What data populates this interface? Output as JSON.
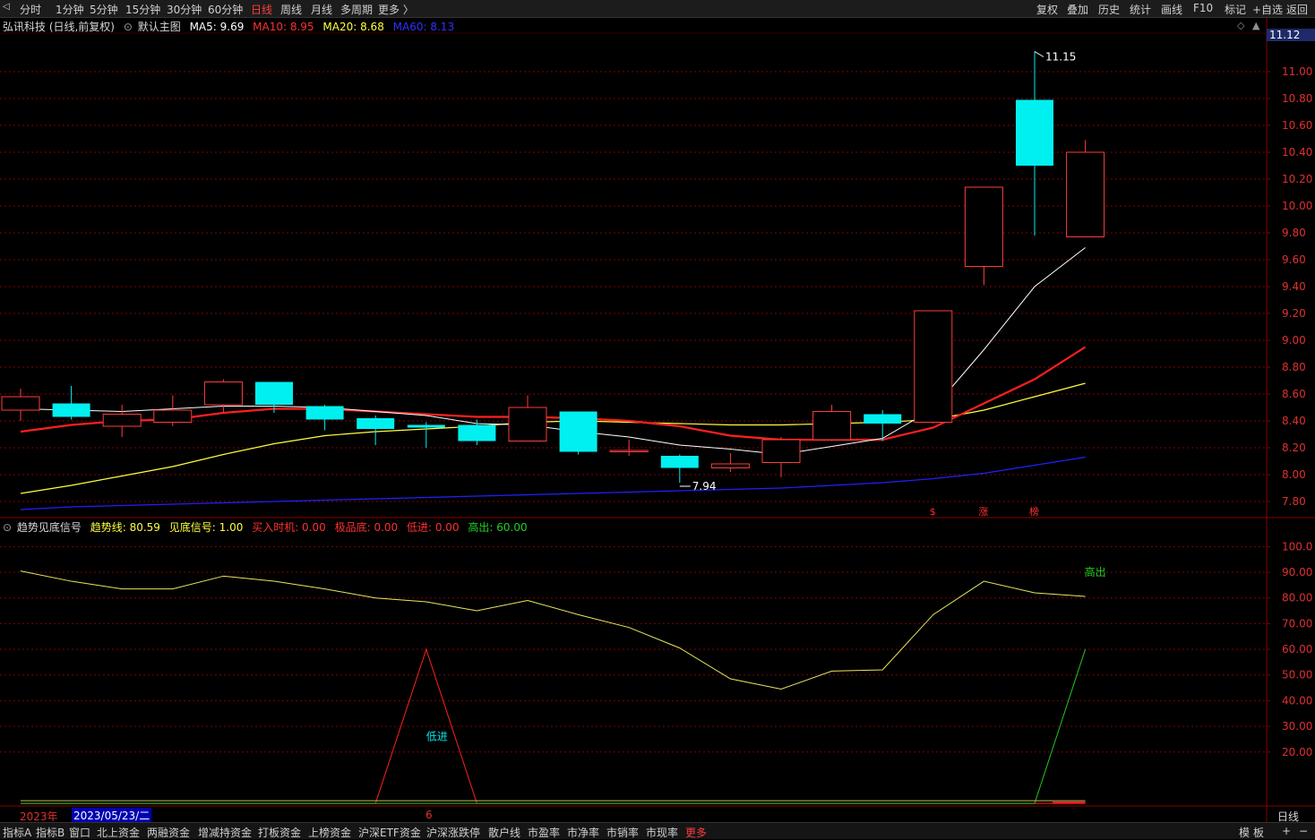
{
  "topbar": {
    "left_items": [
      "分时",
      "1分钟",
      "5分钟",
      "15分钟",
      "30分钟",
      "60分钟",
      "日线",
      "周线",
      "月线",
      "多周期",
      "更多 〉"
    ],
    "active_index": 6,
    "right_items": [
      "复权",
      "叠加",
      "历史",
      "统计",
      "画线",
      "F10",
      "标记",
      "+自选",
      "返回"
    ]
  },
  "main": {
    "stock": "弘讯科技 (日线,前复权)",
    "template": "默认主图",
    "ma5": "MA5: 9.69",
    "ma10": "MA10: 8.95",
    "ma20": "MA20: 8.68",
    "ma60": "MA60: 8.13",
    "price_tag": "11.12",
    "high_label": "11.15",
    "low_label": "7.94",
    "marks": [
      "$",
      "涨",
      "榜"
    ]
  },
  "indicator": {
    "name": "趋势见底信号",
    "trend": "趋势线: 80.59",
    "bottom_signal": "见底信号: 1.00",
    "buy_timing": "买入时机: 0.00",
    "extreme_bottom": "极品底: 0.00",
    "low_entry": "低进: 0.00",
    "high_exit": "高出: 60.00",
    "label_low": "低进",
    "label_high": "高出"
  },
  "datebar": {
    "year": "2023年",
    "date": "2023/05/23/二",
    "month_mark": "6"
  },
  "axis_right_label": "日线",
  "bottombar": {
    "items": [
      "指标A",
      "指标B",
      "窗口",
      "北上资金",
      "两融资金",
      "增减持资金",
      "打板资金",
      "上榜资金",
      "沪深ETF资金",
      "沪深涨跌停",
      "散户线",
      "市盈率",
      "市净率",
      "市销率",
      "市现率",
      "更多"
    ],
    "right": [
      "模",
      "板",
      "+",
      "−"
    ]
  },
  "chart_data": {
    "type": "candlestick",
    "price_axis": [
      "11.00",
      "10.80",
      "10.60",
      "10.40",
      "10.20",
      "10.00",
      "9.80",
      "9.60",
      "9.40",
      "9.20",
      "9.00",
      "8.80",
      "8.60",
      "8.40",
      "8.20",
      "8.00",
      "7.80"
    ],
    "ylim": [
      7.68,
      11.28
    ],
    "candles": [
      {
        "o": 8.48,
        "c": 8.58,
        "h": 8.64,
        "l": 8.4
      },
      {
        "o": 8.53,
        "c": 8.43,
        "h": 8.66,
        "l": 8.41
      },
      {
        "o": 8.36,
        "c": 8.45,
        "h": 8.52,
        "l": 8.28
      },
      {
        "o": 8.39,
        "c": 8.48,
        "h": 8.59,
        "l": 8.36
      },
      {
        "o": 8.52,
        "c": 8.69,
        "h": 8.71,
        "l": 8.46
      },
      {
        "o": 8.69,
        "c": 8.52,
        "h": 8.69,
        "l": 8.46
      },
      {
        "o": 8.51,
        "c": 8.41,
        "h": 8.52,
        "l": 8.33
      },
      {
        "o": 8.42,
        "c": 8.34,
        "h": 8.44,
        "l": 8.22
      },
      {
        "o": 8.37,
        "c": 8.35,
        "h": 8.39,
        "l": 8.2
      },
      {
        "o": 8.37,
        "c": 8.25,
        "h": 8.41,
        "l": 8.22
      },
      {
        "o": 8.25,
        "c": 8.5,
        "h": 8.59,
        "l": 8.25
      },
      {
        "o": 8.47,
        "c": 8.17,
        "h": 8.47,
        "l": 8.15
      },
      {
        "o": 8.17,
        "c": 8.18,
        "h": 8.26,
        "l": 8.14
      },
      {
        "o": 8.14,
        "c": 8.05,
        "h": 8.15,
        "l": 7.94
      },
      {
        "o": 8.05,
        "c": 8.08,
        "h": 8.16,
        "l": 8.02
      },
      {
        "o": 8.09,
        "c": 8.26,
        "h": 8.28,
        "l": 7.98
      },
      {
        "o": 8.26,
        "c": 8.47,
        "h": 8.52,
        "l": 8.25
      },
      {
        "o": 8.45,
        "c": 8.38,
        "h": 8.48,
        "l": 8.25
      },
      {
        "o": 8.39,
        "c": 9.22,
        "h": 9.22,
        "l": 8.38
      },
      {
        "o": 9.55,
        "c": 10.14,
        "h": 10.14,
        "l": 9.41
      },
      {
        "o": 10.79,
        "c": 10.3,
        "h": 11.15,
        "l": 9.78
      },
      {
        "o": 9.77,
        "c": 10.4,
        "h": 10.49,
        "l": 9.77
      }
    ],
    "ma5": [
      8.49,
      8.48,
      8.47,
      8.49,
      8.51,
      8.51,
      8.5,
      8.47,
      8.44,
      8.38,
      8.37,
      8.32,
      8.28,
      8.22,
      8.19,
      8.15,
      8.21,
      8.27,
      8.49,
      8.93,
      9.4,
      9.69
    ],
    "ma10": [
      8.32,
      8.37,
      8.4,
      8.41,
      8.46,
      8.49,
      8.49,
      8.47,
      8.45,
      8.43,
      8.43,
      8.42,
      8.4,
      8.36,
      8.29,
      8.26,
      8.26,
      8.26,
      8.35,
      8.53,
      8.71,
      8.95
    ],
    "ma20": [
      7.86,
      7.92,
      7.99,
      8.06,
      8.15,
      8.23,
      8.29,
      8.32,
      8.34,
      8.36,
      8.39,
      8.4,
      8.39,
      8.38,
      8.37,
      8.37,
      8.38,
      8.39,
      8.41,
      8.48,
      8.58,
      8.68
    ],
    "ma60": [
      7.74,
      7.76,
      7.77,
      7.78,
      7.79,
      7.8,
      7.81,
      7.82,
      7.83,
      7.84,
      7.85,
      7.86,
      7.87,
      7.88,
      7.89,
      7.9,
      7.92,
      7.94,
      7.97,
      8.01,
      8.07,
      8.13
    ],
    "indicator_axis": [
      "100.0",
      "90.00",
      "80.00",
      "70.00",
      "60.00",
      "50.00",
      "40.00",
      "30.00",
      "20.00"
    ],
    "indicator_ylim": [
      -1,
      105
    ],
    "trend": [
      90.5,
      86.5,
      83.5,
      83.5,
      88.5,
      86.5,
      83.5,
      80.0,
      78.5,
      75.0,
      79.0,
      73.5,
      68.5,
      60.5,
      48.5,
      44.5,
      51.5,
      52.0,
      73.5,
      86.5,
      82.0,
      80.59
    ],
    "low_entry": [
      0,
      0,
      0,
      0,
      0,
      0,
      0,
      0,
      60,
      0,
      0,
      0,
      0,
      0,
      0,
      0,
      0,
      0,
      0,
      0,
      0,
      0
    ],
    "high_exit": [
      0,
      0,
      0,
      0,
      0,
      0,
      0,
      0,
      0,
      0,
      0,
      0,
      0,
      0,
      0,
      0,
      0,
      0,
      0,
      0,
      0,
      60
    ],
    "colors": {
      "up": "#ff3c3c",
      "down": "#00f0f0",
      "ma5": "#ffffff",
      "ma10": "#ff2020",
      "ma20": "#ffff40",
      "ma60": "#2020ff",
      "trend": "#e8e860",
      "low": "#ff2020",
      "high": "#20c820",
      "grid": "#8a0000"
    }
  }
}
